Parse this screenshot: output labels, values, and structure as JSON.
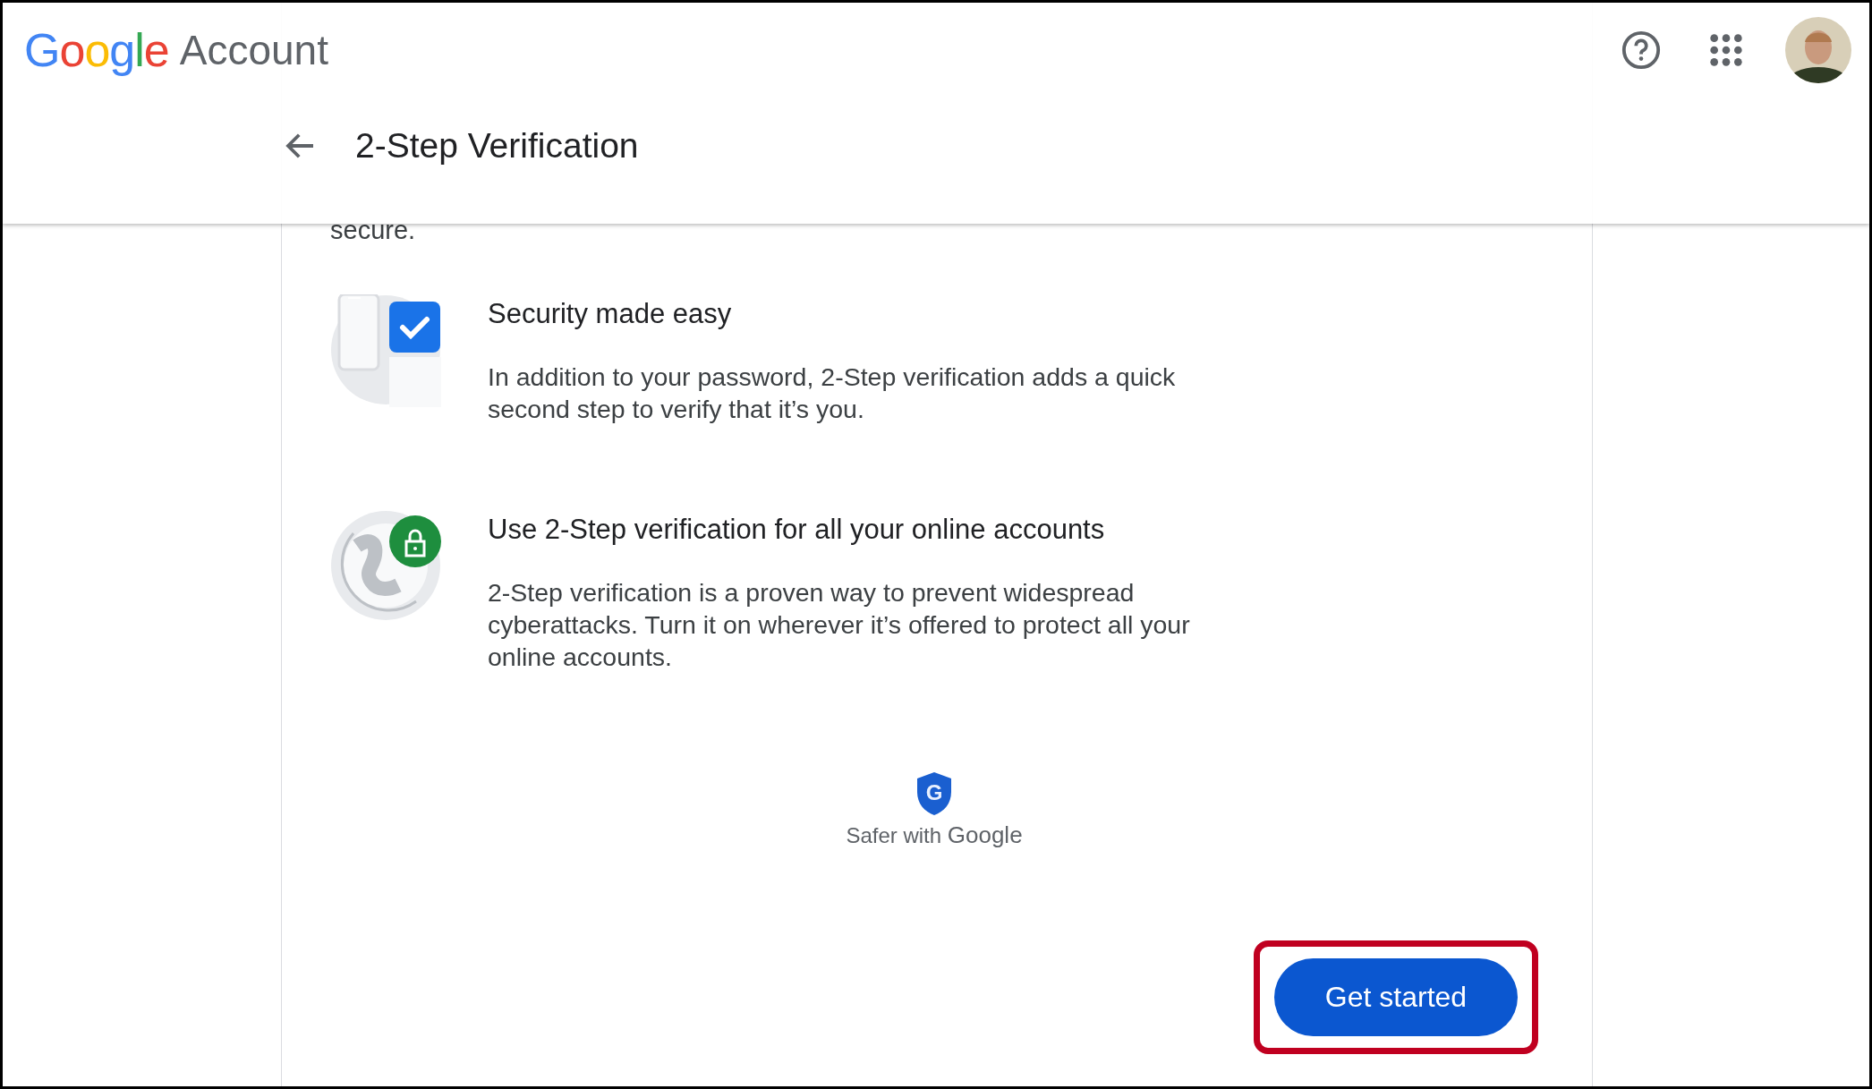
{
  "header": {
    "logo": "Google",
    "product": "Account",
    "page_title": "2-Step Verification"
  },
  "intro": {
    "text": "secure."
  },
  "features": [
    {
      "kind": "devices",
      "title": "Security made easy",
      "text": "In addition to your password, 2-Step verification adds a quick second step to verify that it’s you."
    },
    {
      "kind": "globe",
      "title": "Use 2-Step verification for all your online accounts",
      "text": "2-Step verification is a proven way to prevent widespread cyberattacks. Turn it on wherever it’s offered to protect all your online accounts."
    }
  ],
  "badge": {
    "letter": "G",
    "prefix": "Safer with",
    "brand": "Google"
  },
  "button": {
    "label": "Get started",
    "highlighted": true
  }
}
